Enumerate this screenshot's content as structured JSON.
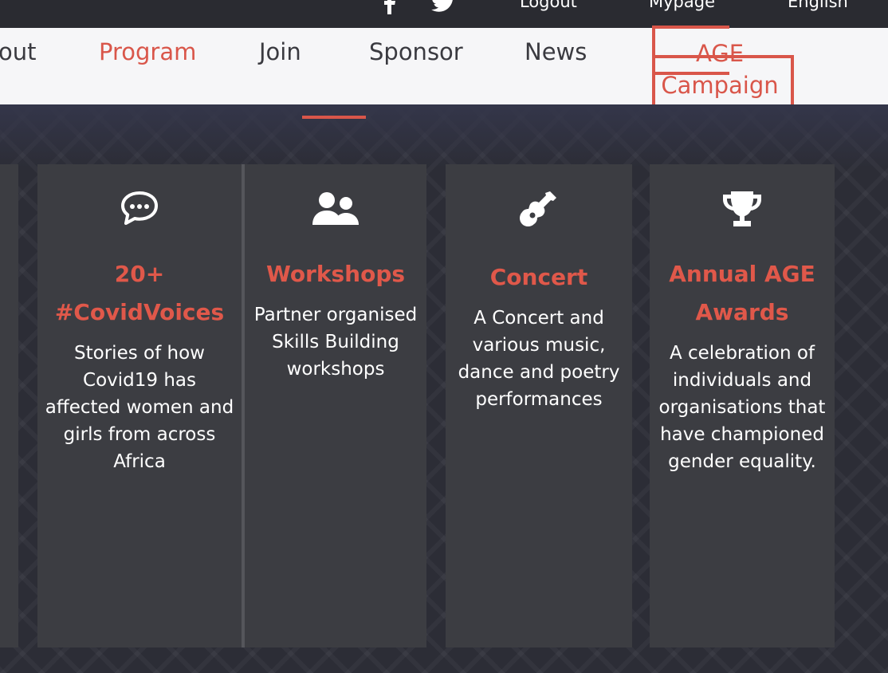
{
  "topbar": {
    "logout": "Logout",
    "mypage": "Mypage",
    "language": "English",
    "social_icons": [
      "facebook-icon",
      "twitter-icon"
    ]
  },
  "nav": {
    "about": "out",
    "program": "Program",
    "join": "Join",
    "sponsor": "Sponsor",
    "news": "News",
    "age_campaign": "AGE Campaign"
  },
  "cards": [
    {
      "icon": "speech-bubble-icon",
      "title": "20+ #CovidVoices",
      "desc": "Stories of how Covid19 has affected women and girls from across Africa"
    },
    {
      "icon": "users-icon",
      "title": "Workshops",
      "desc": "Partner organised Skills Building workshops"
    },
    {
      "icon": "guitar-icon",
      "title": "Concert",
      "desc": "A Concert and various music, dance and poetry performances"
    },
    {
      "icon": "trophy-icon",
      "title": "Annual AGE Awards",
      "desc": "A celebration of individuals and organisations that have championed gender equality."
    }
  ],
  "colors": {
    "accent": "#d9564a",
    "card": "#3c3d42",
    "background": "#2c2d36",
    "nav_bg": "#f6f6f8"
  }
}
